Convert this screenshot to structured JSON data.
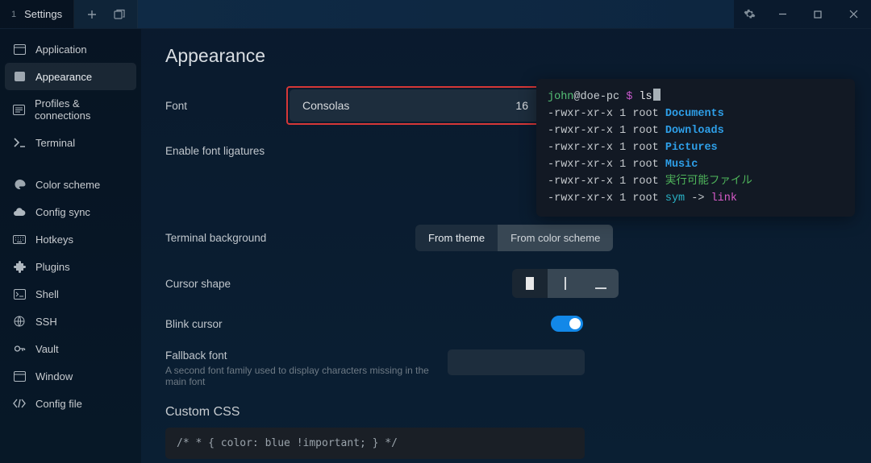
{
  "titlebar": {
    "tab_index": "1",
    "tab_label": "Settings"
  },
  "sidebar": {
    "items": [
      {
        "label": "Application"
      },
      {
        "label": "Appearance"
      },
      {
        "label": "Profiles & connections"
      },
      {
        "label": "Terminal"
      },
      {
        "label": "Color scheme"
      },
      {
        "label": "Config sync"
      },
      {
        "label": "Hotkeys"
      },
      {
        "label": "Plugins"
      },
      {
        "label": "Shell"
      },
      {
        "label": "SSH"
      },
      {
        "label": "Vault"
      },
      {
        "label": "Window"
      },
      {
        "label": "Config file"
      }
    ]
  },
  "page": {
    "title": "Appearance",
    "font_label": "Font",
    "font_name": "Consolas",
    "font_size": "16",
    "ligatures_label": "Enable font ligatures",
    "terminal_bg_label": "Terminal background",
    "terminal_bg_options": [
      "From theme",
      "From color scheme"
    ],
    "cursor_shape_label": "Cursor shape",
    "blink_label": "Blink cursor",
    "fallback_label": "Fallback font",
    "fallback_hint": "A second font family used to display characters missing in the main font",
    "custom_css_label": "Custom CSS",
    "custom_css_value": "/* * { color: blue !important; } */"
  },
  "preview": {
    "user": "john",
    "host": "doe-pc",
    "dollar": "$",
    "cmd": "ls",
    "perm": "-rwxr-xr-x 1 root",
    "entries": [
      "Documents",
      "Downloads",
      "Pictures",
      "Music"
    ],
    "exe": "実行可能ファイル",
    "sym": "sym",
    "arrow": "->",
    "link": "link"
  }
}
